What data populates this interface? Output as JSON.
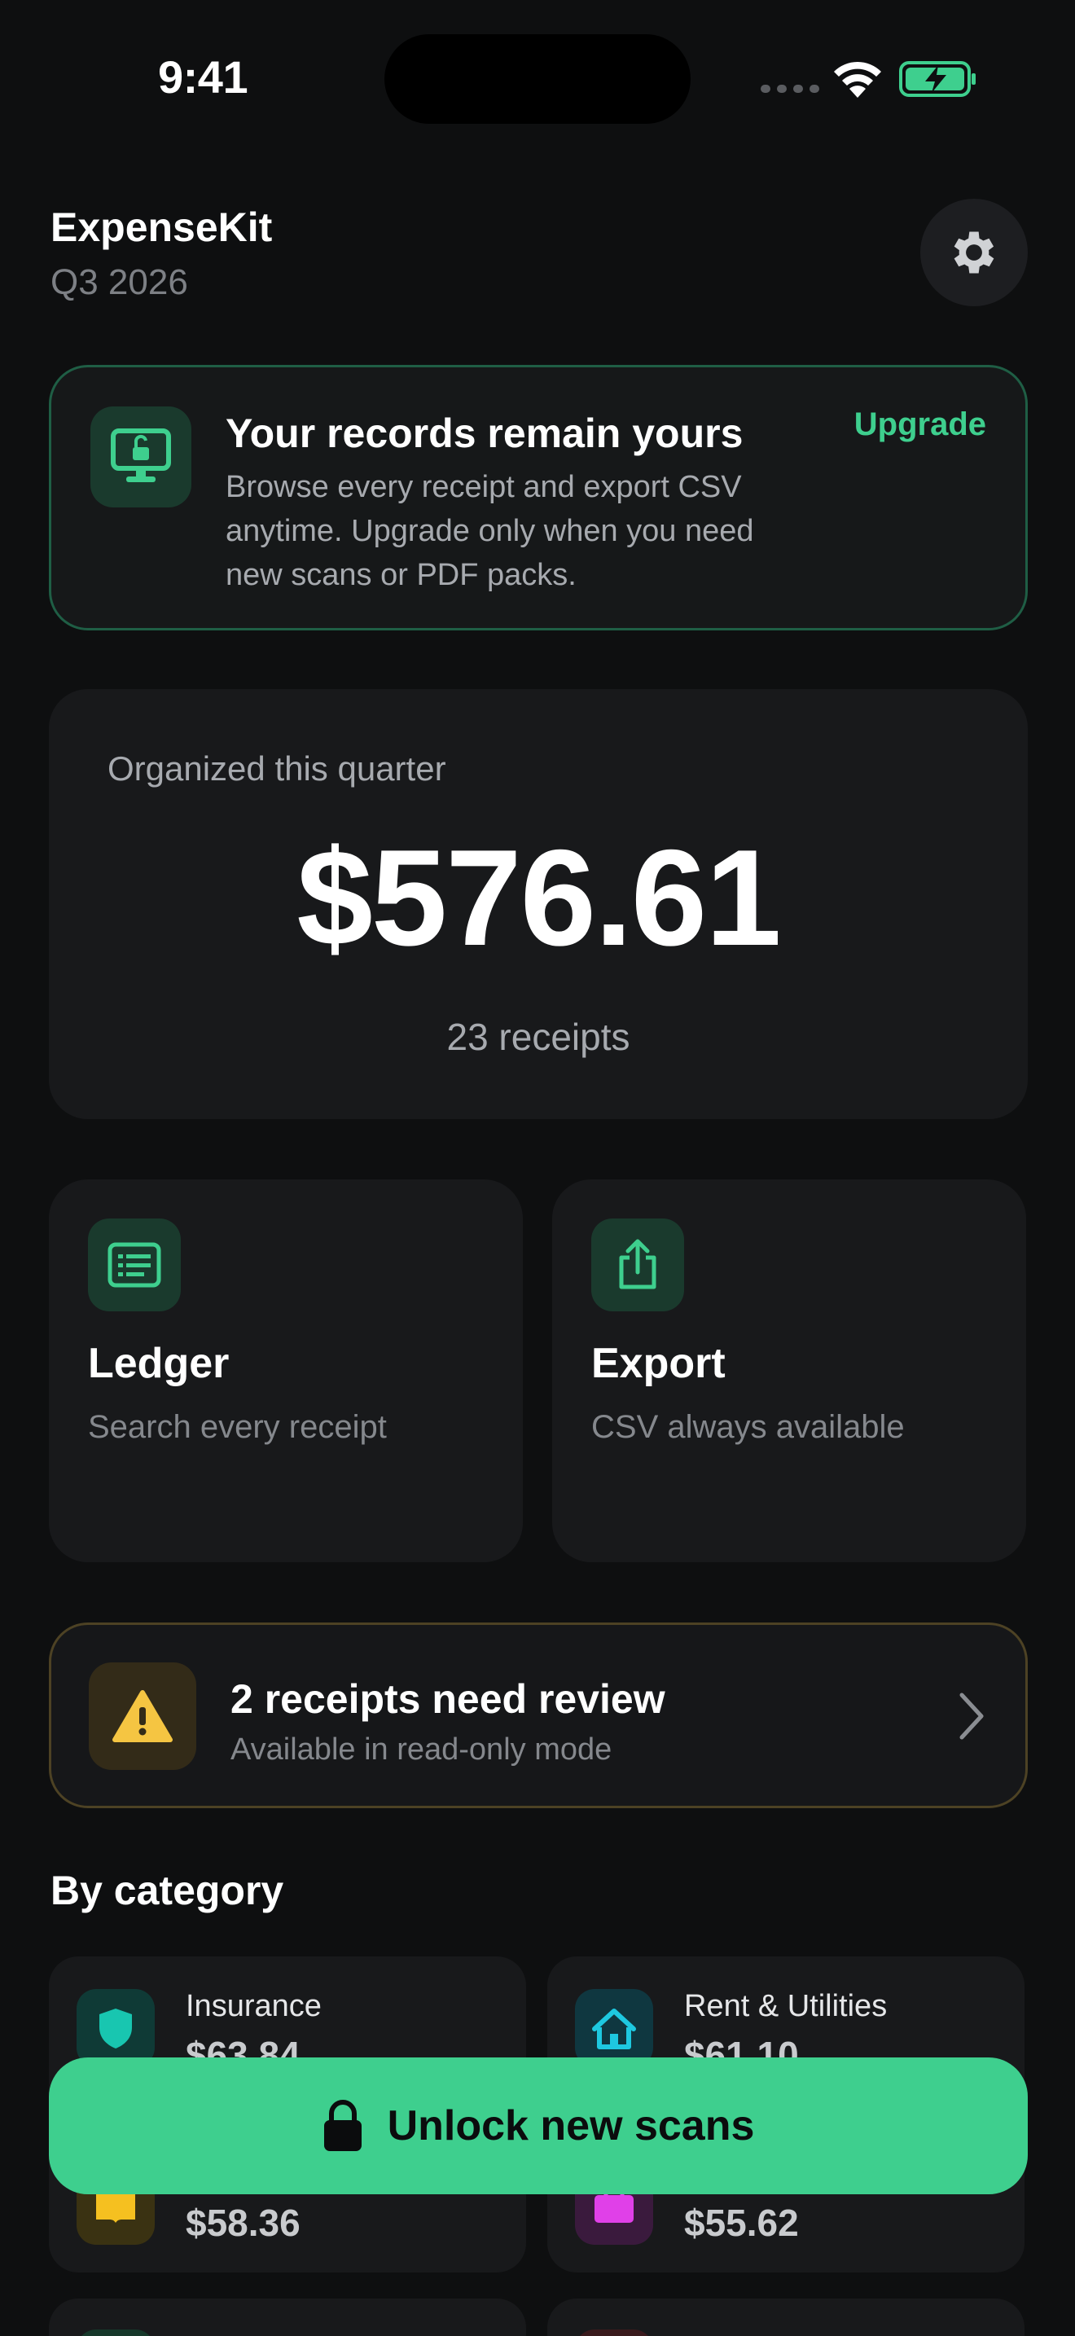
{
  "status_bar": {
    "time": "9:41"
  },
  "header": {
    "app_title": "ExpenseKit",
    "period": "Q3 2026",
    "settings_icon": "gear-icon"
  },
  "banner": {
    "title": "Your records remain yours",
    "body": "Browse every receipt and export CSV anytime. Upgrade only when you need new scans or PDF packs.",
    "action_label": "Upgrade",
    "icon": "monitor-unlock-icon",
    "accent_color": "#3ecf8e"
  },
  "summary": {
    "label": "Organized this quarter",
    "amount": "$576.61",
    "count": "23 receipts"
  },
  "tiles": [
    {
      "title": "Ledger",
      "subtitle": "Search every receipt",
      "icon": "ledger-icon"
    },
    {
      "title": "Export",
      "subtitle": "CSV always available",
      "icon": "share-icon"
    }
  ],
  "review": {
    "title": "2 receipts need review",
    "subtitle": "Available in read-only mode",
    "icon": "warning-icon"
  },
  "categories": {
    "title": "By category",
    "items": [
      {
        "name": "Insurance",
        "amount": "$63.84",
        "icon": "shield-icon",
        "color": "#18c6b0"
      },
      {
        "name": "Rent & Utilities",
        "amount": "$61.10",
        "icon": "house-icon",
        "color": "#1ec8e0"
      },
      {
        "name": "",
        "amount": "$58.36",
        "icon": "book-icon",
        "color": "#f5c020"
      },
      {
        "name": "",
        "amount": "$55.62",
        "icon": "bag-icon",
        "color": "#e040e8"
      }
    ]
  },
  "cta": {
    "label": "Unlock new scans",
    "icon": "lock-icon",
    "color": "#3ecf8e"
  }
}
